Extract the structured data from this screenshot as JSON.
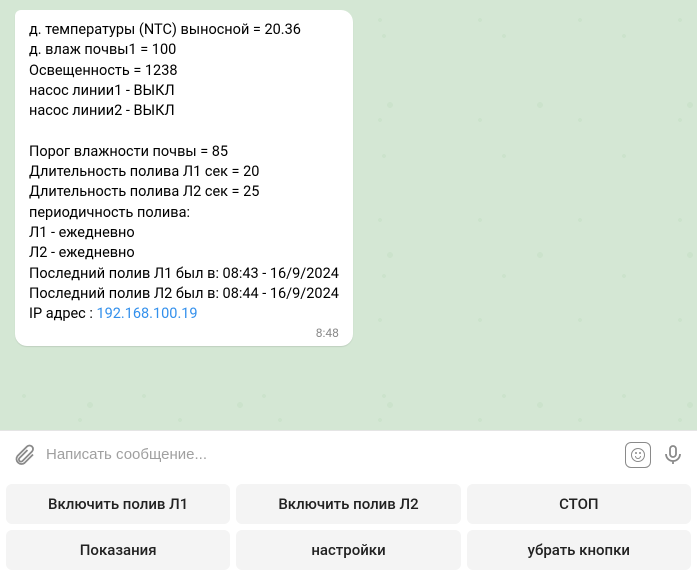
{
  "message": {
    "lines": {
      "l1": "д. температуры (NTC) выносной = 20.36",
      "l2": "д. влаж почвы1 = 100",
      "l3": "Освещенность = 1238",
      "l4": "насос линии1 - ВЫКЛ",
      "l5": "насос линии2 - ВЫКЛ",
      "l6": "",
      "l7": "Порог влажности почвы = 85",
      "l8": "Длительность полива Л1 сек = 20",
      "l9": "Длительность полива Л2 сек = 25",
      "l10": "периодичность полива:",
      "l11": "Л1 - ежедневно",
      "l12": "Л2 - ежедневно",
      "l13": "Последний полив Л1 был в: 08:43 -  16/9/2024",
      "l14": "Последний полив Л2 был в: 08:44 -  16/9/2024",
      "ip_label": "IP адрес : ",
      "ip_value": "192.168.100.19"
    },
    "time": "8:48"
  },
  "input": {
    "placeholder": "Написать сообщение..."
  },
  "keyboard": {
    "row1": {
      "btn1": "Включить полив Л1",
      "btn2": "Включить полив Л2",
      "btn3": "СТОП"
    },
    "row2": {
      "btn1": "Показания",
      "btn2": "настройки",
      "btn3": "убрать кнопки"
    }
  }
}
